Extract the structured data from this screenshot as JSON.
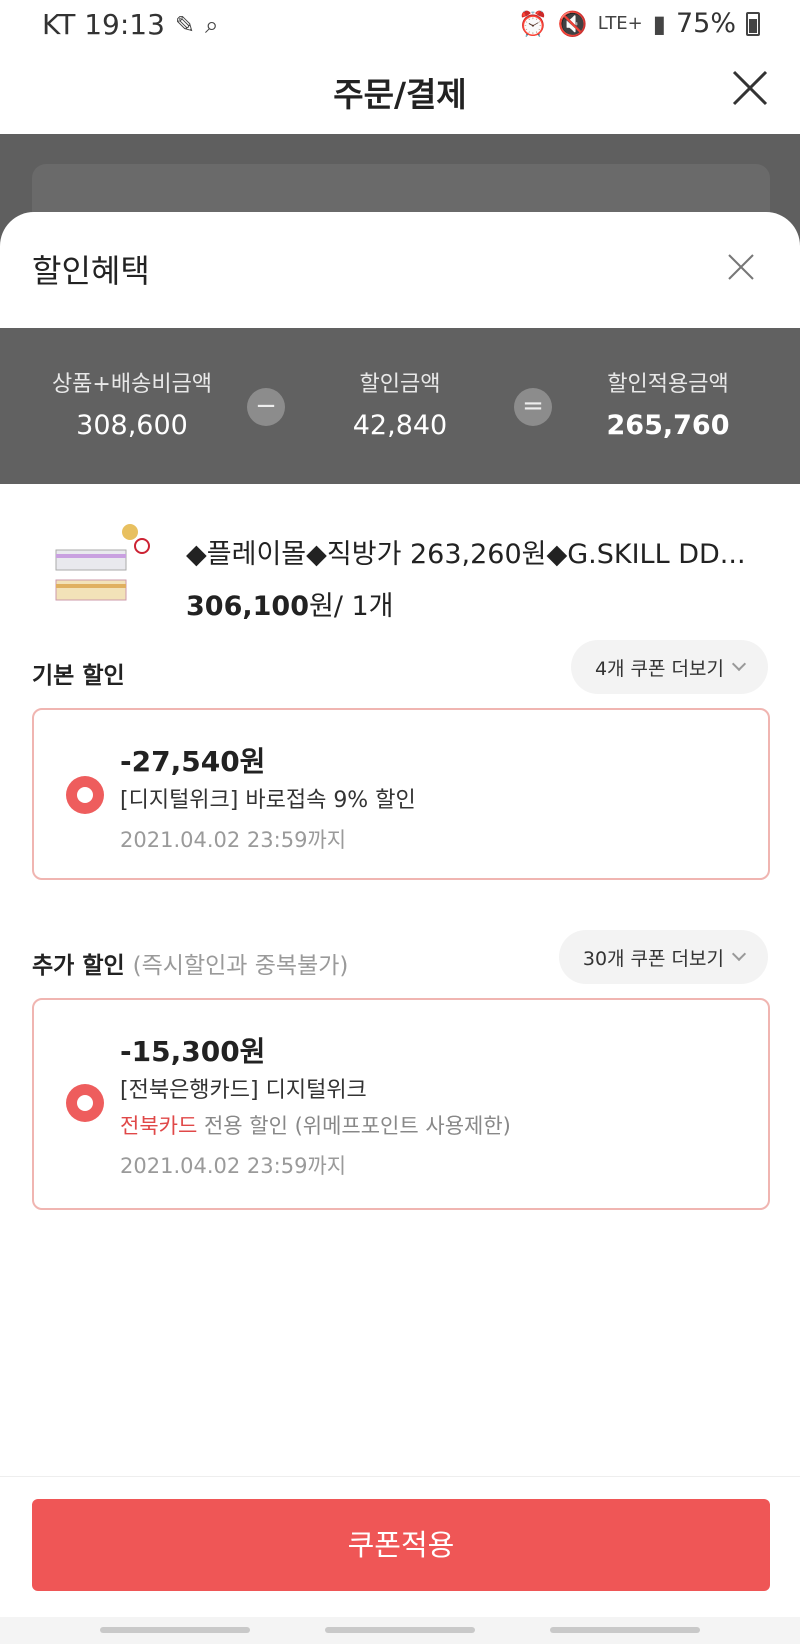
{
  "status_bar": {
    "carrier_time": "KT 19:13",
    "network": "LTE+",
    "battery": "75%"
  },
  "header": {
    "title": "주문/결제"
  },
  "sheet": {
    "title": "할인혜택",
    "summary": {
      "original_label": "상품+배송비금액",
      "original_value": "308,600",
      "minus_symbol": "−",
      "discount_label": "할인금액",
      "discount_value": "42,840",
      "equals_symbol": "=",
      "final_label": "할인적용금액",
      "final_value": "265,760"
    },
    "product": {
      "name": "◆플레이몰◆직방가 263,260원◆G.SKILL DD...",
      "price": "306,100",
      "price_unit": "원/ 1개"
    },
    "basic_discount": {
      "label": "기본 할인",
      "more_label": "4개 쿠폰 더보기",
      "coupon": {
        "amount": "-27,540원",
        "desc": "[디지털위크] 바로접속 9% 할인",
        "date": "2021.04.02 23:59까지"
      }
    },
    "extra_discount": {
      "label": "추가 할인",
      "note": "(즉시할인과 중복불가)",
      "more_label": "30개 쿠폰 더보기",
      "coupon": {
        "amount": "-15,300원",
        "desc": "[전북은행카드] 디지털위크",
        "sub_red": "전북카드",
        "sub_rest": " 전용 할인 (위메프포인트 사용제한)",
        "date": "2021.04.02 23:59까지"
      }
    },
    "apply_button": "쿠폰적용"
  },
  "colors": {
    "accent": "#ef5656",
    "summary_bg": "#616161",
    "coupon_border": "#f0b5b1"
  }
}
